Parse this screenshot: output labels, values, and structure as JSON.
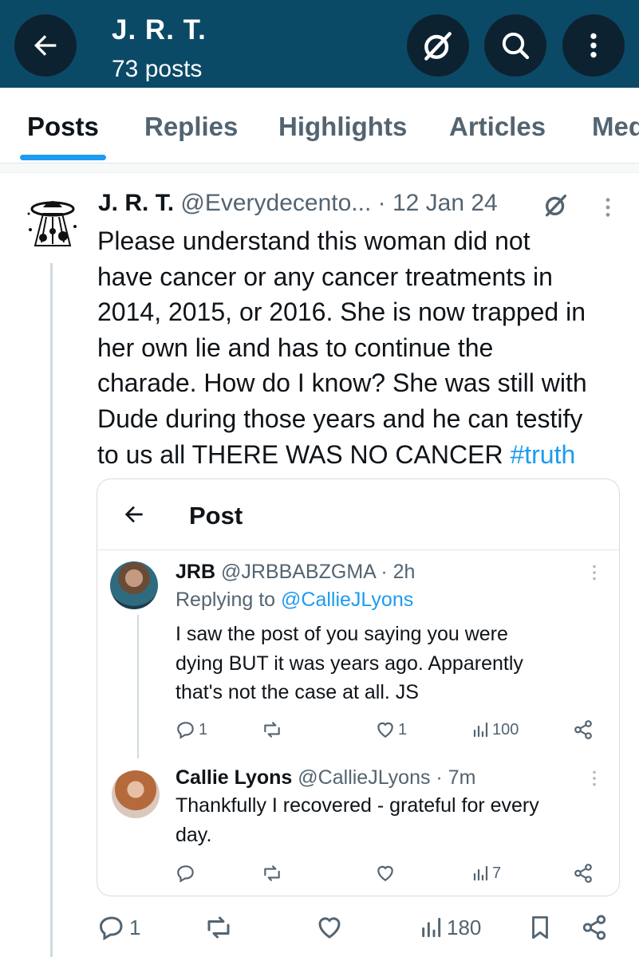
{
  "header": {
    "title": "J. R. T.",
    "post_count": "73 posts",
    "bg_color": "#0b4a67"
  },
  "tabs": [
    {
      "label": "Posts",
      "active": true
    },
    {
      "label": "Replies",
      "active": false
    },
    {
      "label": "Highlights",
      "active": false
    },
    {
      "label": "Articles",
      "active": false
    },
    {
      "label": "Media",
      "active": false
    }
  ],
  "post": {
    "author_name": "J. R. T.",
    "handle": "@Everydecento...",
    "date": "· 12 Jan 24",
    "text_lines": [
      "Please understand this woman did not",
      "have cancer or any cancer treatments in",
      "2014, 2015, or 2016. She is now trapped in",
      "her own lie and has to continue the",
      "charade. How do I know? She was still with",
      "Dude during those years and he can testify",
      "to us all THERE WAS NO CANCER "
    ],
    "hashtag": "#truth",
    "replies": "1",
    "views": "180"
  },
  "quoted": {
    "title": "Post",
    "first": {
      "name": "JRB",
      "handle": "@JRBBABZGMA · 2h",
      "replying_prefix": "Replying to ",
      "replying_to": "@CallieJLyons",
      "text_lines": [
        "I saw the post of you saying you were",
        "dying BUT it was years ago. Apparently",
        "that's not the case at all. JS"
      ],
      "replies": "1",
      "likes": "1",
      "views": "100"
    },
    "second": {
      "name": "Callie Lyons",
      "handle": "@CallieJLyons · 7m",
      "text_lines": [
        "Thankfully I recovered - grateful for every",
        "day."
      ],
      "views": "7"
    }
  },
  "colors": {
    "accent": "#1d9bf0",
    "muted": "#536471",
    "text": "#0f1419"
  }
}
